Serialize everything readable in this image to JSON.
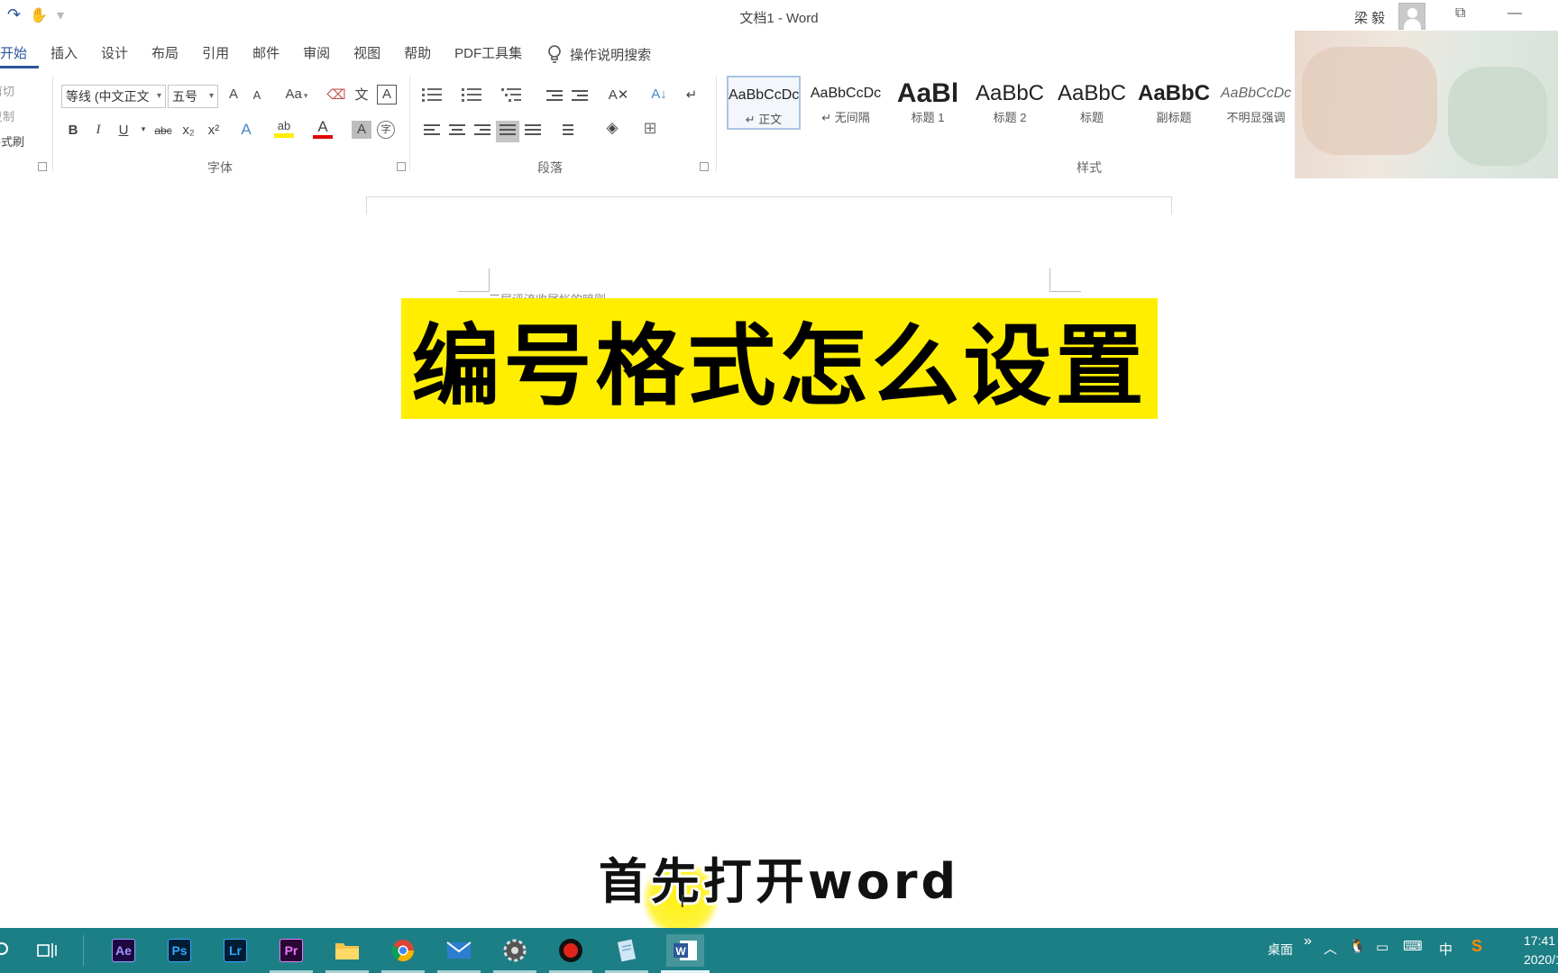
{
  "window": {
    "title": "文档1 - Word",
    "user_name": "梁 毅",
    "restore_glyph": "⧉",
    "minimize_glyph": "—"
  },
  "quick_access": {
    "redo_icon": "redo-icon",
    "touch_icon": "touch-mode-icon",
    "customize_glyph": "▾"
  },
  "tabs": [
    "开始",
    "插入",
    "设计",
    "布局",
    "引用",
    "邮件",
    "审阅",
    "视图",
    "帮助",
    "PDF工具集"
  ],
  "tell_me": "操作说明搜索",
  "clipboard": {
    "cut": "剪切",
    "copy": "复制",
    "format_painter": "格式刷"
  },
  "font_group": {
    "label": "字体",
    "font_name": "等线 (中文正文",
    "font_size": "五号",
    "grow": "A",
    "shrink": "A",
    "change_case": "Aa",
    "bold": "B",
    "italic": "I",
    "underline": "U",
    "strike": "abc",
    "subscript": "x₂",
    "superscript": "x²",
    "text_effects": "A",
    "highlight": "ab",
    "font_color": "A",
    "shading": "A",
    "enclose": "字",
    "phonetic": "文",
    "border_char": "A",
    "clear_format_glyph": "⌫"
  },
  "paragraph_group": {
    "label": "段落",
    "sort": "A↓",
    "show_marks": "↵",
    "asian_layout": "A✕"
  },
  "styles_group": {
    "label": "样式",
    "items": [
      {
        "sample": "AaBbCcDc",
        "name": "↵ 正文"
      },
      {
        "sample": "AaBbCcDc",
        "name": "↵ 无间隔"
      },
      {
        "sample": "AaBl",
        "name": "标题 1"
      },
      {
        "sample": "AaBbC",
        "name": "标题 2"
      },
      {
        "sample": "AaBbC",
        "name": "标题"
      },
      {
        "sample": "AaBbC",
        "name": "副标题"
      },
      {
        "sample": "AaBbCcDc",
        "name": "不明显强调"
      }
    ]
  },
  "document": {
    "faint_line": "三层评流收尾帐的暗则"
  },
  "overlay": {
    "headline": "编号格式怎么设置",
    "subtitle": "首先打开word",
    "ibeam": "I"
  },
  "taskbar": {
    "apps": [
      {
        "icon": "ae-icon",
        "label": "Ae"
      },
      {
        "icon": "ps-icon",
        "label": "Ps"
      },
      {
        "icon": "lr-icon",
        "label": "Lr"
      },
      {
        "icon": "pr-icon",
        "label": "Pr"
      }
    ],
    "desktop_label": "桌面",
    "overflow_glyph": "»",
    "ime_label": "中",
    "time": "17:41",
    "date": "2020/1"
  },
  "colors": {
    "accent": "#2b579a",
    "headline_bg": "#ffee00",
    "taskbar_bg": "#1d7f86",
    "ae": "#9999ff",
    "ps": "#31a8ff",
    "lr": "#31a8ff",
    "pr": "#ea77ff"
  }
}
